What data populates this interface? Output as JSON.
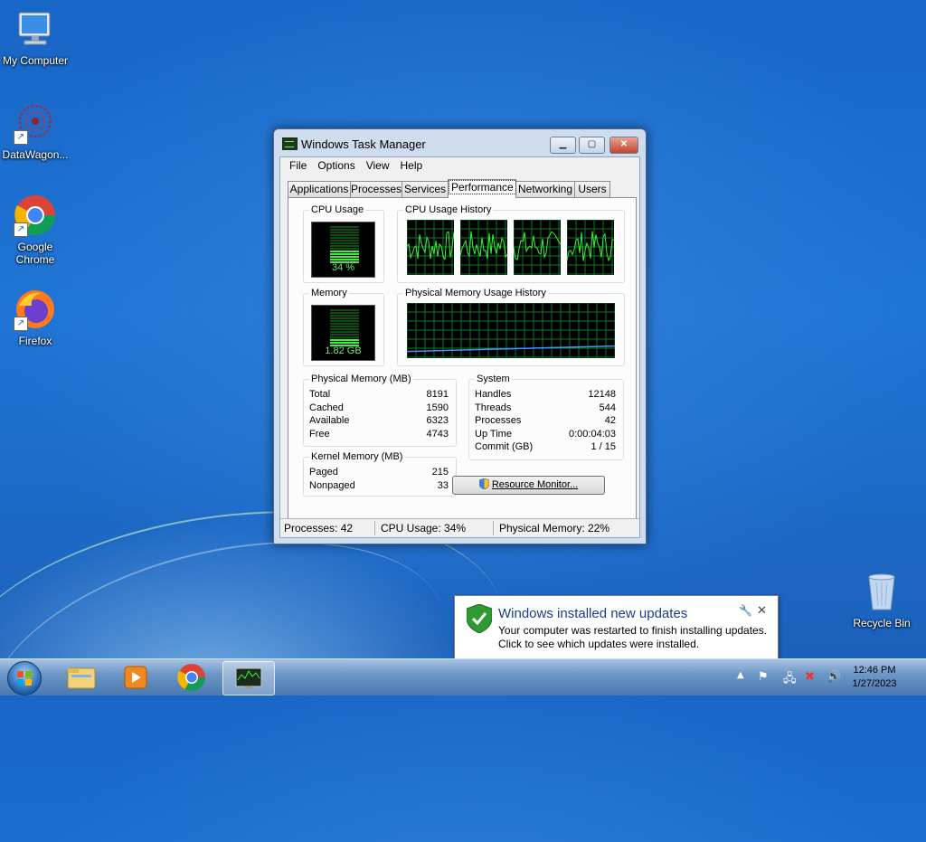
{
  "desktop": {
    "icons": [
      {
        "label": "My Computer"
      },
      {
        "label": "DataWagon..."
      },
      {
        "label": "Google Chrome"
      },
      {
        "label": "Firefox"
      },
      {
        "label": "Recycle Bin"
      }
    ]
  },
  "task_manager": {
    "title": "Windows Task Manager",
    "menu": [
      "File",
      "Options",
      "View",
      "Help"
    ],
    "tabs": [
      "Applications",
      "Processes",
      "Services",
      "Performance",
      "Networking",
      "Users"
    ],
    "active_tab": "Performance",
    "cpu_usage": {
      "label": "CPU Usage",
      "value_text": "34 %",
      "percent": 34
    },
    "cpu_history": {
      "label": "CPU Usage History"
    },
    "memory": {
      "label": "Memory",
      "value_text": "1.82 GB",
      "percent": 22
    },
    "memory_history": {
      "label": "Physical Memory Usage History"
    },
    "physical_memory": {
      "label": "Physical Memory (MB)",
      "rows": [
        {
          "name": "Total",
          "value": "8191"
        },
        {
          "name": "Cached",
          "value": "1590"
        },
        {
          "name": "Available",
          "value": "6323"
        },
        {
          "name": "Free",
          "value": "4743"
        }
      ]
    },
    "kernel_memory": {
      "label": "Kernel Memory (MB)",
      "rows": [
        {
          "name": "Paged",
          "value": "215"
        },
        {
          "name": "Nonpaged",
          "value": "33"
        }
      ]
    },
    "system": {
      "label": "System",
      "rows": [
        {
          "name": "Handles",
          "value": "12148"
        },
        {
          "name": "Threads",
          "value": "544"
        },
        {
          "name": "Processes",
          "value": "42"
        },
        {
          "name": "Up Time",
          "value": "0:00:04:03"
        },
        {
          "name": "Commit (GB)",
          "value": "1 / 15"
        }
      ]
    },
    "resource_monitor_button": "Resource Monitor...",
    "status": {
      "processes": "Processes: 42",
      "cpu": "CPU Usage: 34%",
      "memory": "Physical Memory: 22%"
    }
  },
  "notification": {
    "title": "Windows installed new updates",
    "line1": "Your computer was restarted to finish installing updates.",
    "line2": "Click to see which updates were installed."
  },
  "taskbar": {
    "time": "12:46 PM",
    "date": "1/27/2023",
    "pinned": [
      "start-orb-icon",
      "explorer-icon",
      "media-player-icon",
      "chrome-icon",
      "task-manager-icon"
    ]
  },
  "colors": {
    "graph_green": "#3cf03c",
    "grid_green": "#0a7a2a",
    "memory_line": "#4f8fff"
  }
}
